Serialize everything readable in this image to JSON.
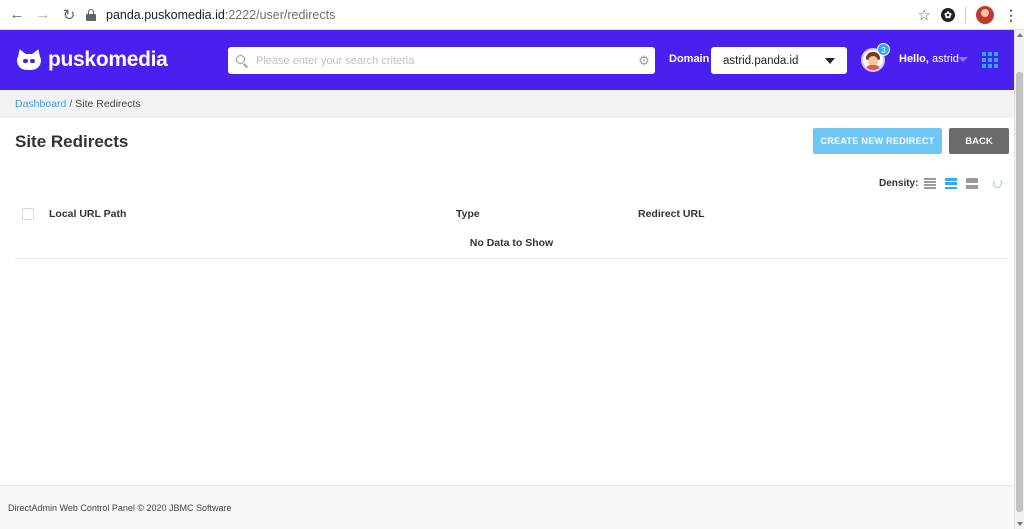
{
  "browser": {
    "url_host": "panda.puskomedia.id",
    "url_rest": ":2222/user/redirects"
  },
  "header": {
    "logo_text": "puskomedia",
    "search_placeholder": "Please enter your search criteria",
    "domain_label": "Domain",
    "domain_value": "astrid.panda.id",
    "notification_count": "3",
    "hello_prefix": "Hello,",
    "username": "astrid"
  },
  "breadcrumb": {
    "link": "Dashboard",
    "separator": "/",
    "current": "Site Redirects"
  },
  "page": {
    "title": "Site Redirects",
    "create_button": "CREATE NEW REDIRECT",
    "back_button": "BACK",
    "density_label": "Density:"
  },
  "table": {
    "columns": [
      "Local URL Path",
      "Type",
      "Redirect URL"
    ],
    "empty_text": "No Data to Show"
  },
  "footer": {
    "text": "DirectAdmin Web Control Panel © 2020 JBMC Software"
  },
  "colors": {
    "header_bg": "#4a20f0",
    "accent": "#2fa8f5",
    "create_button": "#6ec6f5",
    "back_button": "#6b6b6b"
  }
}
